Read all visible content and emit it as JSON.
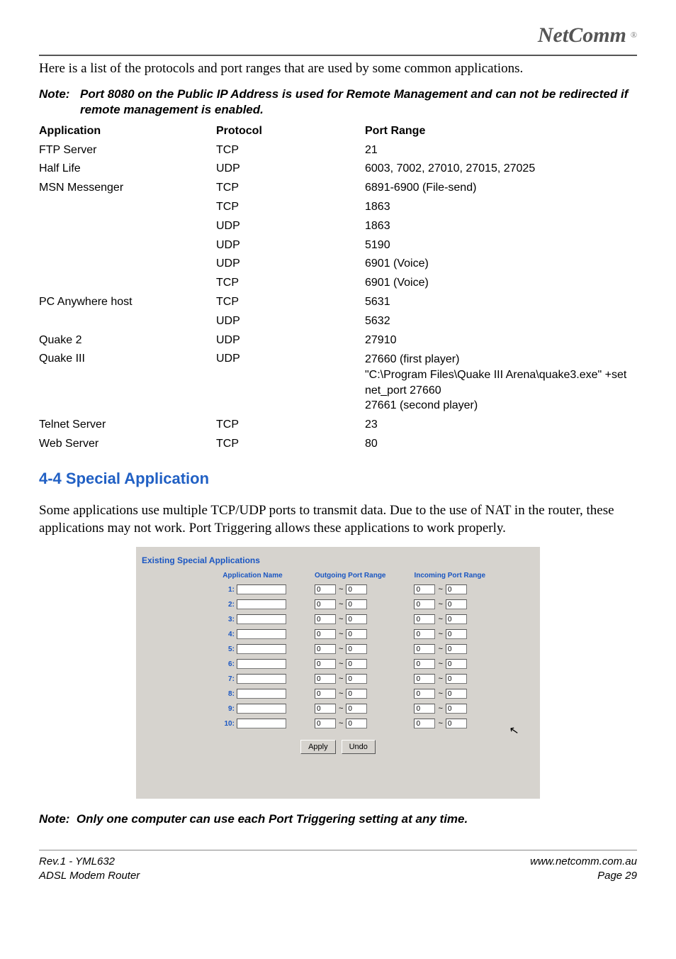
{
  "logo": {
    "text": "NetComm",
    "mark": "®"
  },
  "intro": "Here is a list of the protocols and port ranges that are used by some common applications.",
  "note1": {
    "label": "Note:",
    "body": "Port 8080 on the Public IP Address is used for Remote Management and can not be redirected if remote management is enabled."
  },
  "table": {
    "headers": [
      "Application",
      "Protocol",
      "Port Range"
    ],
    "rows": [
      {
        "app": "FTP Server",
        "proto": "TCP",
        "range": "21"
      },
      {
        "app": "Half Life",
        "proto": "UDP",
        "range": "6003, 7002, 27010, 27015, 27025"
      },
      {
        "app": "MSN Messenger",
        "proto": "TCP",
        "range": "6891-6900 (File-send)"
      },
      {
        "app": "",
        "proto": "TCP",
        "range": "1863"
      },
      {
        "app": "",
        "proto": "UDP",
        "range": "1863"
      },
      {
        "app": "",
        "proto": "UDP",
        "range": "5190"
      },
      {
        "app": "",
        "proto": "UDP",
        "range": "6901 (Voice)"
      },
      {
        "app": "",
        "proto": "TCP",
        "range": "6901 (Voice)"
      },
      {
        "app": "PC Anywhere host",
        "proto": "TCP",
        "range": "5631"
      },
      {
        "app": "",
        "proto": "UDP",
        "range": "5632"
      },
      {
        "app": "Quake 2",
        "proto": "UDP",
        "range": "27910"
      },
      {
        "app": "Quake III",
        "proto": "UDP",
        "range_multi": [
          "27660 (first player)",
          "\"C:\\Program Files\\Quake III Arena\\quake3.exe\" +set net_port 27660",
          "27661 (second player)"
        ]
      },
      {
        "app": "Telnet Server",
        "proto": "TCP",
        "range": "23"
      },
      {
        "app": "Web Server",
        "proto": "TCP",
        "range": "80"
      }
    ]
  },
  "section_heading": "4-4 Special Application",
  "section_body": "Some applications use multiple TCP/UDP ports to transmit data. Due to the use of NAT in the router, these applications may not work. Port Triggering allows these applications to work properly.",
  "screenshot": {
    "title": "Existing Special Applications",
    "col_heads": [
      "Application Name",
      "Outgoing Port Range",
      "Incoming Port Range"
    ],
    "rows": [
      "1:",
      "2:",
      "3:",
      "4:",
      "5:",
      "6:",
      "7:",
      "8:",
      "9:",
      "10:"
    ],
    "port_default": "0",
    "tilde": "~",
    "buttons": {
      "apply": "Apply",
      "undo": "Undo"
    }
  },
  "note2": {
    "label": "Note:",
    "body": "Only one computer can use each Port Triggering setting at any time."
  },
  "footer": {
    "left1": "Rev.1 - YML632",
    "left2": "ADSL Modem Router",
    "right1": "www.netcomm.com.au",
    "right2": "Page 29"
  }
}
